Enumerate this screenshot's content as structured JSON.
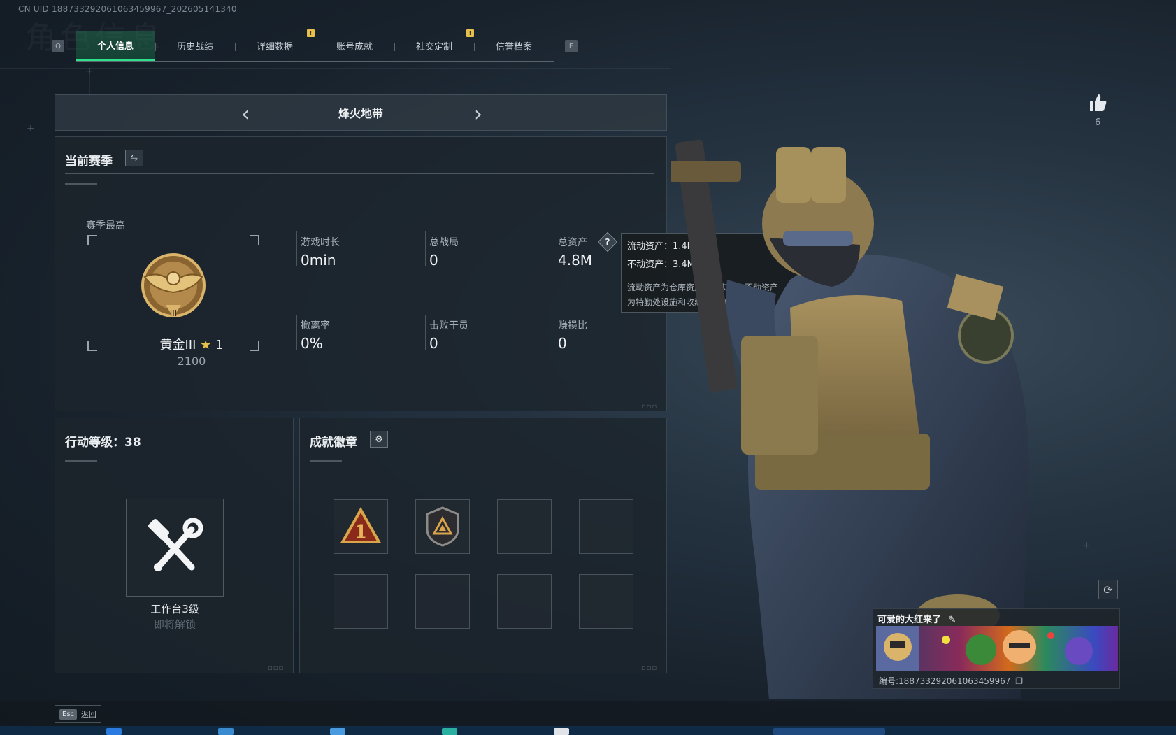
{
  "uid_line": "CN UID 188733292061063459967_202605141340",
  "watermark": "角色信息",
  "tabs": {
    "left_key": "Q",
    "right_key": "E",
    "items": [
      {
        "label": "个人信息",
        "active": true,
        "notify": false
      },
      {
        "label": "历史战绩",
        "active": false,
        "notify": false
      },
      {
        "label": "详细数据",
        "active": false,
        "notify": true
      },
      {
        "label": "账号成就",
        "active": false,
        "notify": false
      },
      {
        "label": "社交定制",
        "active": false,
        "notify": true
      },
      {
        "label": "信誉档案",
        "active": false,
        "notify": false
      }
    ],
    "notify_glyph": "!"
  },
  "mode": {
    "title": "烽火地带",
    "prev_glyph": "‹",
    "next_glyph": "›"
  },
  "season": {
    "title": "当前赛季",
    "switch_glyph": "⇋",
    "highest_label": "赛季最高",
    "rank_name": "黄金III",
    "rank_stars": "1",
    "rank_score": "2100",
    "stats": [
      {
        "label": "游戏时长",
        "value": "0min"
      },
      {
        "label": "总战局",
        "value": "0"
      },
      {
        "label": "总资产",
        "value": "4.8M"
      },
      {
        "label": "撤离率",
        "value": "0%"
      },
      {
        "label": "击败干员",
        "value": "0"
      },
      {
        "label": "赚损比",
        "value": "0"
      }
    ],
    "help_glyph": "?"
  },
  "tooltip": {
    "liquid": "流动资产：1.4M",
    "fixed": "不动资产：3.4M",
    "desc_line1": "流动资产为仓库资产和哈夫币，不动资产",
    "desc_line2": "为特勤处设施和收藏室设施"
  },
  "action": {
    "title": "行动等级：38",
    "bench_name": "工作台3级",
    "bench_sub": "即将解锁"
  },
  "badges": {
    "title": "成就徽章",
    "gear_glyph": "⚙",
    "slots": [
      {
        "filled": true,
        "kind": "rank-1-badge"
      },
      {
        "filled": true,
        "kind": "shield-badge"
      },
      {
        "filled": false
      },
      {
        "filled": false
      },
      {
        "filled": false
      },
      {
        "filled": false
      },
      {
        "filled": false
      },
      {
        "filled": false
      }
    ]
  },
  "profile": {
    "like_count": "6",
    "refresh_glyph": "⟳",
    "card_name": "可爱的大红来了",
    "card_edit_glyph": "✎",
    "card_id": "编号:188733292061063459967"
  },
  "bottom": {
    "esc_key": "Esc",
    "esc_label": "返回"
  },
  "colors": {
    "accent": "#2fe08c",
    "notify": "#e6c04a",
    "gold": "#c99a4a"
  }
}
